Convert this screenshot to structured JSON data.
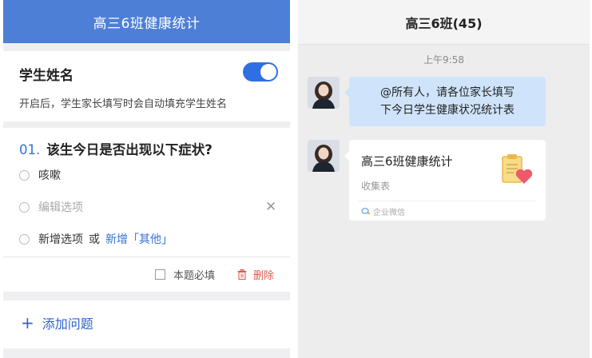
{
  "form_editor": {
    "header_title": "高三6班健康统计",
    "student_name": {
      "title": "学生姓名",
      "toggle_on": true,
      "description": "开启后，学生家长填写时会自动填充学生姓名"
    },
    "question": {
      "number": "01.",
      "title": "该生今日是否出现以下症状?",
      "options": [
        {
          "label": "咳嗽"
        },
        {
          "placeholder": "编辑选项"
        }
      ],
      "add_option": "新增选项",
      "or_text": "或",
      "add_other": "新增「其他」",
      "required_label": "本题必填",
      "delete_label": "删除"
    },
    "add_question": "添加问题"
  },
  "chat": {
    "header_title": "高三6班(45)",
    "time": "上午9:58",
    "message": {
      "line1": "@所有人，请各位家长填写",
      "line2": "下今日学生健康状况统计表"
    },
    "card": {
      "title": "高三6班健康统计",
      "subtitle": "收集表",
      "source": "企业微信"
    }
  },
  "colors": {
    "accent_blue": "#4d7fd6",
    "toggle_blue": "#2f6fe4",
    "link_blue": "#3572d8",
    "delete_red": "#e05a50",
    "bubble_blue": "#cfe4fa"
  },
  "icons": [
    "toggle-switch",
    "radio-icon",
    "close-icon",
    "checkbox-icon",
    "trash-icon",
    "plus-icon",
    "avatar",
    "clipboard-heart-icon",
    "wecom-icon"
  ]
}
